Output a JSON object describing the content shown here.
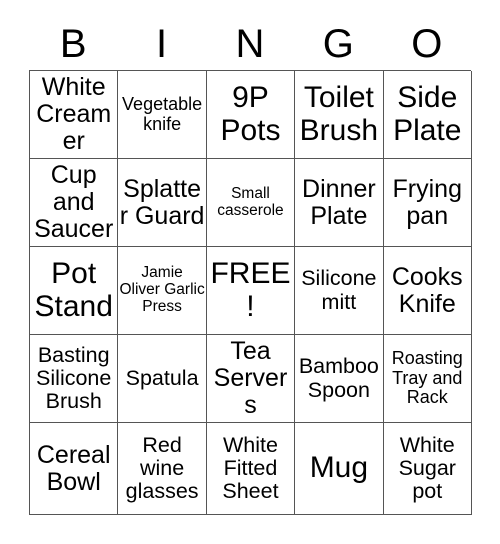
{
  "card": {
    "title_letters": [
      "B",
      "I",
      "N",
      "G",
      "O"
    ],
    "free_space_label": "FREE!",
    "colors": {
      "background": "#ffffff",
      "text": "#000000",
      "border": "#555555"
    },
    "rows": [
      [
        {
          "label": "White Creamer",
          "size": "lg"
        },
        {
          "label": "Vegetable knife",
          "size": "sm"
        },
        {
          "label": "9P Pots",
          "size": "xl"
        },
        {
          "label": "Toilet Brush",
          "size": "xl"
        },
        {
          "label": "Side Plate",
          "size": "xl"
        }
      ],
      [
        {
          "label": "Cup and Saucer",
          "size": "lg"
        },
        {
          "label": "Splatter Guard",
          "size": "lg"
        },
        {
          "label": "Small casserole",
          "size": "xs"
        },
        {
          "label": "Dinner Plate",
          "size": "lg"
        },
        {
          "label": "Frying pan",
          "size": "lg"
        }
      ],
      [
        {
          "label": "Pot Stand",
          "size": "xl"
        },
        {
          "label": "Jamie Oliver Garlic Press",
          "size": "xs"
        },
        {
          "label": "FREE!",
          "size": "xl"
        },
        {
          "label": "Silicone mitt",
          "size": "md"
        },
        {
          "label": "Cooks Knife",
          "size": "lg"
        }
      ],
      [
        {
          "label": "Basting Silicone Brush",
          "size": "md"
        },
        {
          "label": "Spatula",
          "size": "md"
        },
        {
          "label": "Tea Servers",
          "size": "lg"
        },
        {
          "label": "Bamboo Spoon",
          "size": "md"
        },
        {
          "label": "Roasting Tray and Rack",
          "size": "sm"
        }
      ],
      [
        {
          "label": "Cereal Bowl",
          "size": "lg"
        },
        {
          "label": "Red wine glasses",
          "size": "md"
        },
        {
          "label": "White Fitted Sheet",
          "size": "md"
        },
        {
          "label": "Mug",
          "size": "xl"
        },
        {
          "label": "White Sugar pot",
          "size": "md"
        }
      ]
    ]
  }
}
